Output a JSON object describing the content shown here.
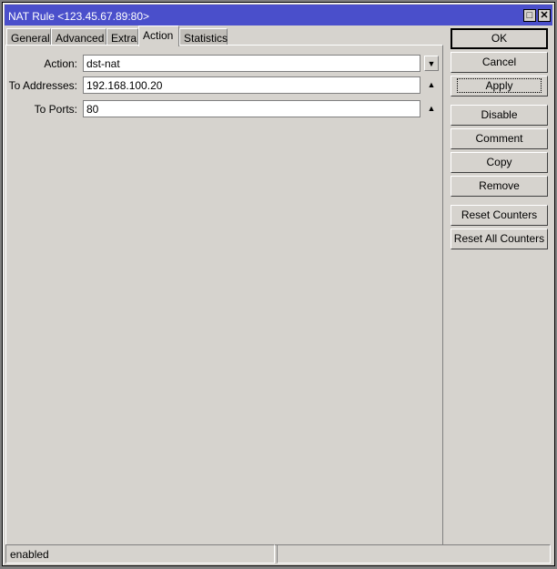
{
  "window": {
    "title": "NAT Rule <123.45.67.89:80>"
  },
  "tabs": [
    {
      "label": "General"
    },
    {
      "label": "Advanced"
    },
    {
      "label": "Extra"
    },
    {
      "label": "Action"
    },
    {
      "label": "Statistics"
    }
  ],
  "fields": {
    "action": {
      "label": "Action:",
      "value": "dst-nat"
    },
    "to_addresses": {
      "label": "To Addresses:",
      "value": "192.168.100.20"
    },
    "to_ports": {
      "label": "To Ports:",
      "value": "80"
    }
  },
  "buttons": {
    "ok": "OK",
    "cancel": "Cancel",
    "apply": "Apply",
    "disable": "Disable",
    "comment": "Comment",
    "copy": "Copy",
    "remove": "Remove",
    "reset_counters": "Reset Counters",
    "reset_all_counters": "Reset All Counters"
  },
  "status": {
    "left": "enabled",
    "right": ""
  }
}
